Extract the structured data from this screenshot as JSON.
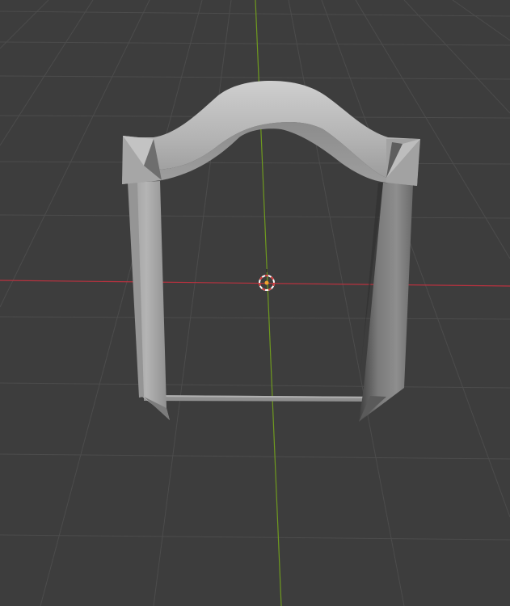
{
  "viewport": {
    "background": "#3d3d3d",
    "grid_color": "#4e4e4e",
    "x_axis_color": "#b8323f",
    "y_axis_color": "#6f9a1f"
  },
  "object": {
    "type": "door-frame-mesh",
    "material_color": "#a8a8a8"
  },
  "cursor_3d": {
    "ring_primary": "#d33b3b",
    "ring_secondary": "#ffffff"
  },
  "origin": {
    "color": "#f0a030"
  }
}
